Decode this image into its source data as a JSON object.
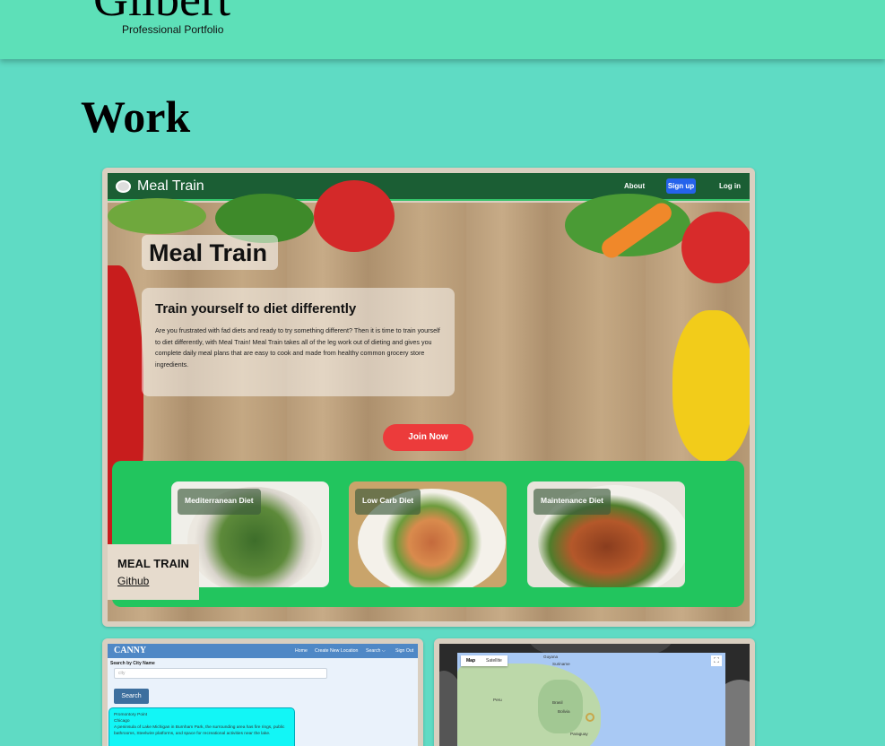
{
  "header": {
    "site_name": "Gilbert",
    "tagline": "Professional Portfolio"
  },
  "section": {
    "title": "Work"
  },
  "projects": [
    {
      "caption_title": "MEAL TRAIN",
      "caption_link": "Github",
      "screenshot": {
        "brand": "Meal Train",
        "nav": {
          "about": "About",
          "signup": "Sign up",
          "login": "Log in"
        },
        "hero_title": "Meal Train",
        "intro_heading": "Train yourself to diet differently",
        "intro_text": "Are you frustrated with fad diets and ready to try something different? Then it is time to train yourself to diet differently, with Meal Train! Meal Train takes all of the leg work out of dieting and gives you complete daily meal plans that are easy to cook and made from healthy common grocery store ingredients.",
        "cta": "Join Now",
        "diets": [
          "Mediterranean Diet",
          "Low Carb Diet",
          "Maintenance Diet"
        ]
      }
    },
    {
      "screenshot": {
        "brand": "CANNY",
        "nav": [
          "Home",
          "Create New Location",
          "Search ⌵",
          "Sign Out"
        ],
        "search_label": "Search by City Name",
        "search_placeholder": "city",
        "search_button": "Search",
        "result": {
          "title": "Promontory Point",
          "city": "Chicago",
          "text": "A peninsula of Lake Michigan in Burnham Park, the surrounding area has fire rings, public bathrooms, Steelwire platforms, and space for recreational activities near the lake."
        }
      }
    },
    {
      "screenshot": {
        "map_tabs": [
          "Map",
          "Satellite"
        ],
        "places": [
          "Guyana",
          "Suriname",
          "Brasil",
          "Bolivia",
          "Peru",
          "Paraguay"
        ]
      }
    }
  ]
}
